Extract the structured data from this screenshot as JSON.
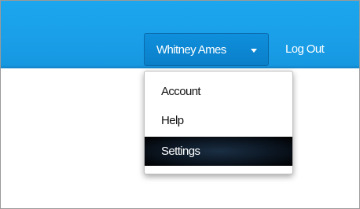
{
  "header": {
    "user_menu": {
      "name": "Whitney Ames",
      "caret_icon": "chevron-down-icon"
    },
    "logout_label": "Log Out",
    "colors": {
      "header_bg": "#1aa2ea",
      "button_bg": "#0b84d0",
      "active_item_bg": "#0b1521"
    }
  },
  "dropdown": {
    "items": [
      {
        "label": "Account",
        "active": false
      },
      {
        "label": "Help",
        "active": false
      },
      {
        "label": "Settings",
        "active": true
      }
    ]
  }
}
